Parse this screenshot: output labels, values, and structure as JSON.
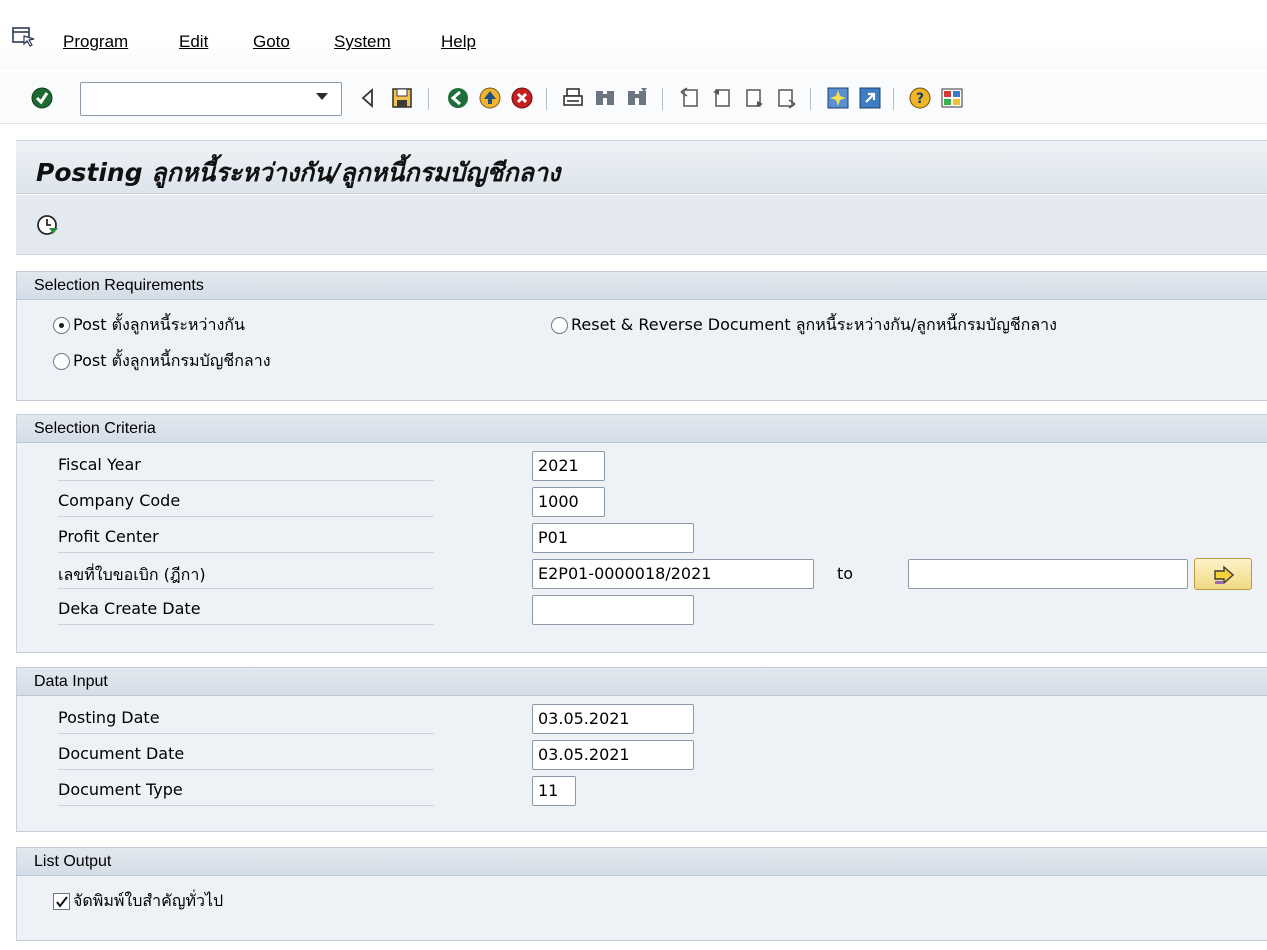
{
  "menu": {
    "items": [
      {
        "label": "Program"
      },
      {
        "label": "Edit"
      },
      {
        "label": "Goto"
      },
      {
        "label": "System"
      },
      {
        "label": "Help"
      }
    ]
  },
  "toolbar": {
    "command_field_value": "",
    "icons": [
      "enter-icon",
      "back-icon",
      "save-icon",
      "back-green-icon",
      "exit-icon",
      "cancel-icon",
      "print-icon",
      "find-icon",
      "find-next-icon",
      "first-page-icon",
      "previous-page-icon",
      "next-page-icon",
      "last-page-icon",
      "create-session-icon",
      "shortcut-icon",
      "help-icon",
      "layout-icon"
    ]
  },
  "title": "Posting ลูกหนี้ระหว่างกัน/ลูกหนี้กรมบัญชีกลาง",
  "execute_icon": "execute-icon",
  "selection_requirements": {
    "header": "Selection Requirements",
    "options": [
      {
        "label": "Post ตั้งลูกหนี้ระหว่างกัน",
        "selected": true
      },
      {
        "label": "Reset & Reverse Document ลูกหนี้ระหว่างกัน/ลูกหนี้กรมบัญชีกลาง",
        "selected": false
      },
      {
        "label": "Post ตั้งลูกหนี้กรมบัญชีกลาง",
        "selected": false
      }
    ]
  },
  "selection_criteria": {
    "header": "Selection Criteria",
    "fields": [
      {
        "label": "Fiscal Year",
        "value": "2021"
      },
      {
        "label": "Company Code",
        "value": "1000"
      },
      {
        "label": "Profit Center",
        "value": "P01"
      },
      {
        "label": "เลขที่ใบขอเบิก (ฎีกา)",
        "value": "E2P01-0000018/2021",
        "to_label": "to",
        "to_value": ""
      },
      {
        "label": "Deka Create Date",
        "value": ""
      }
    ]
  },
  "data_input": {
    "header": "Data Input",
    "fields": [
      {
        "label": "Posting Date",
        "value": "03.05.2021"
      },
      {
        "label": "Document Date",
        "value": "03.05.2021"
      },
      {
        "label": "Document Type",
        "value": "11"
      }
    ]
  },
  "list_output": {
    "header": "List Output",
    "checkbox": {
      "label": "จัดพิมพ์ใบสำคัญทั่วไป",
      "checked": true
    }
  },
  "colors": {
    "group_bg": "#eef2f6",
    "header_bg": "#d4dde7",
    "accent_yellow": "#f1d983"
  }
}
